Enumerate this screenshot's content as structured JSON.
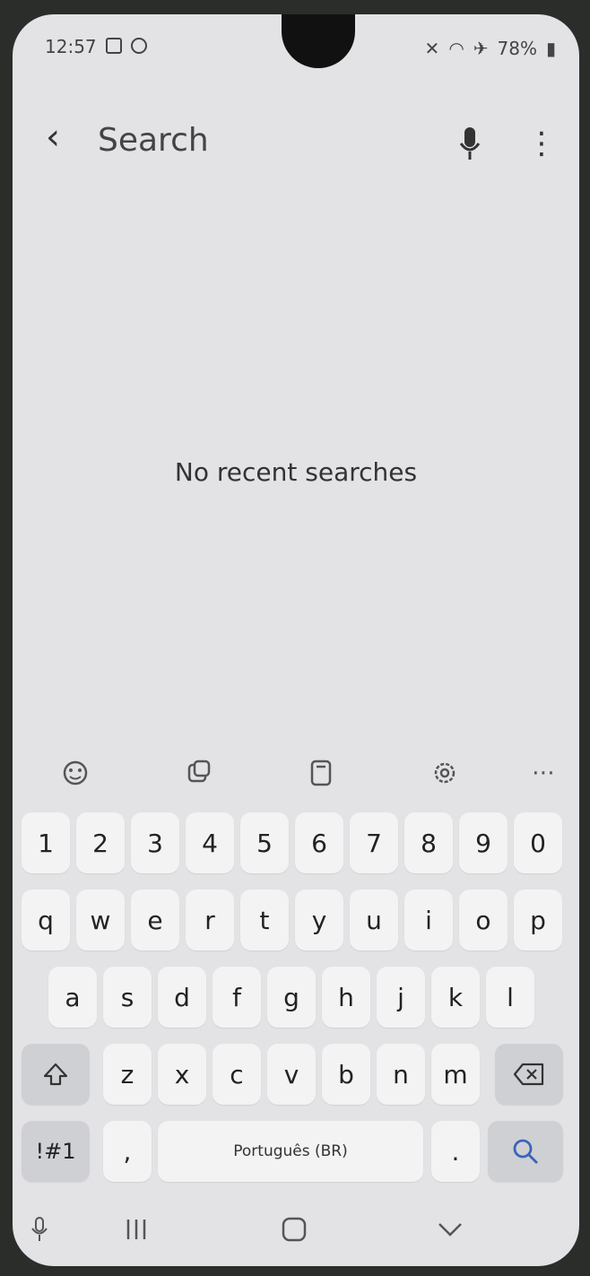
{
  "status": {
    "time": "12:57",
    "battery": "78%",
    "left_icons": [
      "checkbox-icon",
      "timer-icon"
    ],
    "right_icons": [
      "mute-icon",
      "wifi-icon",
      "airplane-icon",
      "battery-icon"
    ]
  },
  "header": {
    "back_icon": "chevron-left-icon",
    "title": "Search",
    "voice_icon": "microphone-icon",
    "more_icon": "more-vert-icon"
  },
  "main": {
    "empty_text": "No recent searches"
  },
  "toolbar": {
    "items": [
      "emoji-icon",
      "sticker-icon",
      "clipboard-icon",
      "settings-icon",
      "more-horiz-icon"
    ]
  },
  "keyboard": {
    "row1": [
      "1",
      "2",
      "3",
      "4",
      "5",
      "6",
      "7",
      "8",
      "9",
      "0"
    ],
    "row2": [
      "q",
      "w",
      "e",
      "r",
      "t",
      "y",
      "u",
      "i",
      "o",
      "p"
    ],
    "row3": [
      "a",
      "s",
      "d",
      "f",
      "g",
      "h",
      "j",
      "k",
      "l"
    ],
    "row4": [
      "z",
      "x",
      "c",
      "v",
      "b",
      "n",
      "m"
    ],
    "symbols_label": "!#1",
    "comma_label": ",",
    "space_label": "Português (BR)",
    "period_label": ".",
    "shift_icon": "shift-icon",
    "backspace_icon": "backspace-icon",
    "search_icon": "search-icon"
  },
  "navbar": {
    "mic_icon": "mic-icon",
    "recents_icon": "recents-icon",
    "home_icon": "home-icon",
    "back_icon": "chevron-down-icon"
  },
  "colors": {
    "search_key_icon": "#3b64b8"
  }
}
